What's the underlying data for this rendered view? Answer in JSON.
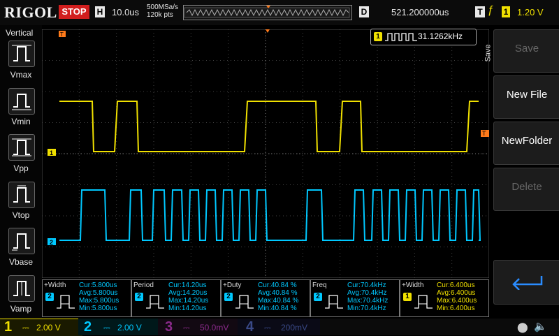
{
  "topbar": {
    "logo": "RIGOL",
    "run_state": "STOP",
    "h_label": "H",
    "timebase": "10.0us",
    "sample_rate": "500MSa/s",
    "memory_depth": "120k pts",
    "d_label": "D",
    "delay": "521.200000us",
    "t_label": "T",
    "trigger_channel": "1",
    "trigger_level": "1.20 V"
  },
  "left_menu": {
    "title": "Vertical",
    "items": [
      {
        "label": "Vmax",
        "icon": "vmax-icon"
      },
      {
        "label": "Vmin",
        "icon": "vmin-icon"
      },
      {
        "label": "Vpp",
        "icon": "vpp-icon"
      },
      {
        "label": "Vtop",
        "icon": "vtop-icon"
      },
      {
        "label": "Vbase",
        "icon": "vbase-icon"
      },
      {
        "label": "Vamp",
        "icon": "vamp-icon"
      }
    ]
  },
  "right_menu": {
    "side_label": "Save",
    "keys": [
      {
        "label": "Save",
        "enabled": false
      },
      {
        "label": "New File",
        "enabled": true
      },
      {
        "label": "NewFolder",
        "enabled": true
      },
      {
        "label": "Delete",
        "enabled": false
      },
      {
        "label": "",
        "icon": "return-icon",
        "enabled": true
      }
    ]
  },
  "frequency_counter": {
    "channel": "1",
    "value": "31.1262kHz"
  },
  "channel_markers": {
    "ch1": "1",
    "ch2": "2",
    "trigger": "T"
  },
  "measurements": [
    {
      "name": "+Width",
      "channel": "2",
      "color": "#00c8ff",
      "cur": "Cur:5.800us",
      "avg": "Avg:5.800us",
      "max": "Max:5.800us",
      "min": "Min:5.800us"
    },
    {
      "name": "Period",
      "channel": "2",
      "color": "#00c8ff",
      "cur": "Cur:14.20us",
      "avg": "Avg:14.20us",
      "max": "Max:14.20us",
      "min": "Min:14.20us"
    },
    {
      "name": "+Duty",
      "channel": "2",
      "color": "#00c8ff",
      "cur": "Cur:40.84 %",
      "avg": "Avg:40.84 %",
      "max": "Max:40.84 %",
      "min": "Min:40.84 %"
    },
    {
      "name": "Freq",
      "channel": "2",
      "color": "#00c8ff",
      "cur": "Cur:70.4kHz",
      "avg": "Avg:70.4kHz",
      "max": "Max:70.4kHz",
      "min": "Min:70.4kHz"
    },
    {
      "name": "+Width",
      "channel": "1",
      "color": "#f0e000",
      "cur": "Cur:6.400us",
      "avg": "Avg:6.400us",
      "max": "Max:6.400us",
      "min": "Min:6.400us"
    }
  ],
  "bottom": {
    "ch1": {
      "num": "1",
      "scale": "2.00 V",
      "color": "#f0e000"
    },
    "ch2": {
      "num": "2",
      "scale": "2.00 V",
      "color": "#00c8ff"
    },
    "ch3": {
      "num": "3",
      "scale": "50.0mV",
      "color": "#c040c0"
    },
    "ch4": {
      "num": "4",
      "scale": "200mV",
      "color": "#3060ff"
    }
  },
  "colors": {
    "ch1": "#f0e000",
    "ch2": "#00c8ff",
    "stop": "#d21e1e",
    "trigger_marker": "#ff7a1a"
  }
}
